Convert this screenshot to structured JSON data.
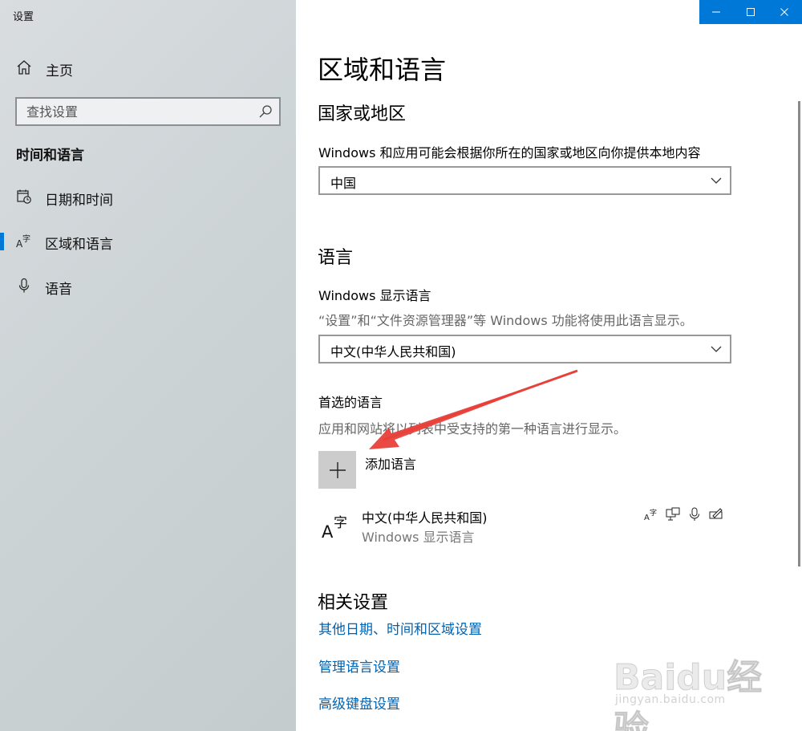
{
  "window": {
    "title": "设置"
  },
  "sidebar": {
    "home_label": "主页",
    "search_placeholder": "查找设置",
    "section_title": "时间和语言",
    "items": [
      {
        "label": "日期和时间",
        "icon": "calendar-clock-icon",
        "selected": false
      },
      {
        "label": "区域和语言",
        "icon": "language-icon",
        "selected": true
      },
      {
        "label": "语音",
        "icon": "microphone-icon",
        "selected": false
      }
    ]
  },
  "main": {
    "title": "区域和语言",
    "country": {
      "heading": "国家或地区",
      "description": "Windows 和应用可能会根据你所在的国家或地区向你提供本地内容",
      "selected": "中国"
    },
    "language": {
      "heading": "语言",
      "display_label": "Windows 显示语言",
      "display_desc": "“设置”和“文件资源管理器”等 Windows 功能将使用此语言显示。",
      "display_selected": "中文(中华人民共和国)",
      "preferred_label": "首选的语言",
      "preferred_desc": "应用和网站将以列表中受支持的第一种语言进行显示。",
      "add_label": "添加语言",
      "installed": [
        {
          "name": "中文(中华人民共和国)",
          "sub": "Windows 显示语言",
          "features": [
            "language-pack-icon",
            "display-icon",
            "speech-icon",
            "handwriting-icon"
          ]
        }
      ]
    },
    "related": {
      "heading": "相关设置",
      "links": [
        "其他日期、时间和区域设置",
        "管理语言设置",
        "高级键盘设置"
      ]
    }
  },
  "watermark": {
    "brand": "Baidu经验",
    "url": "jingyan.baidu.com"
  },
  "colors": {
    "accent": "#0078d7",
    "link": "#0063b1",
    "annotation_arrow": "#e8403a"
  }
}
